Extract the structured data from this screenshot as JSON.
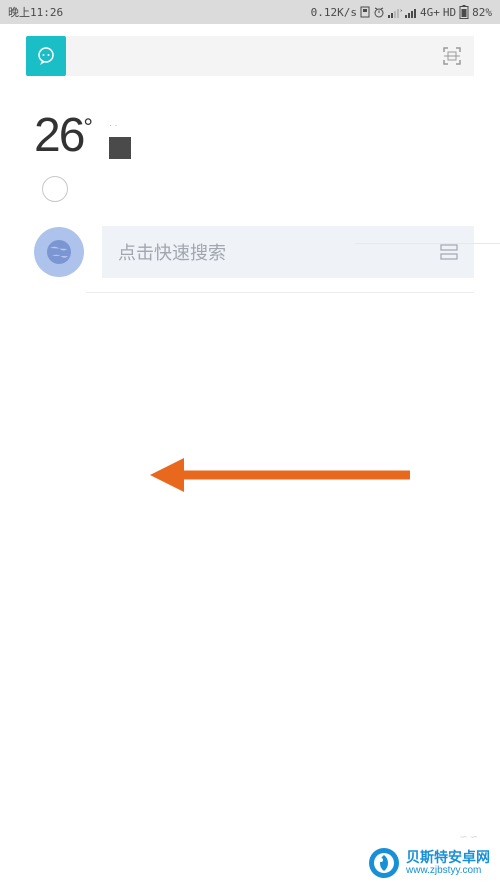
{
  "status": {
    "time": "晚上11:26",
    "speed": "0.12K/s",
    "network": "4G+",
    "hd": "HD",
    "battery": "82%"
  },
  "weather": {
    "temp": "26",
    "degree": "°"
  },
  "search": {
    "placeholder": "点击快速搜索"
  },
  "watermark": {
    "title": "贝斯特安卓网",
    "url": "www.zjbstyy.com"
  }
}
